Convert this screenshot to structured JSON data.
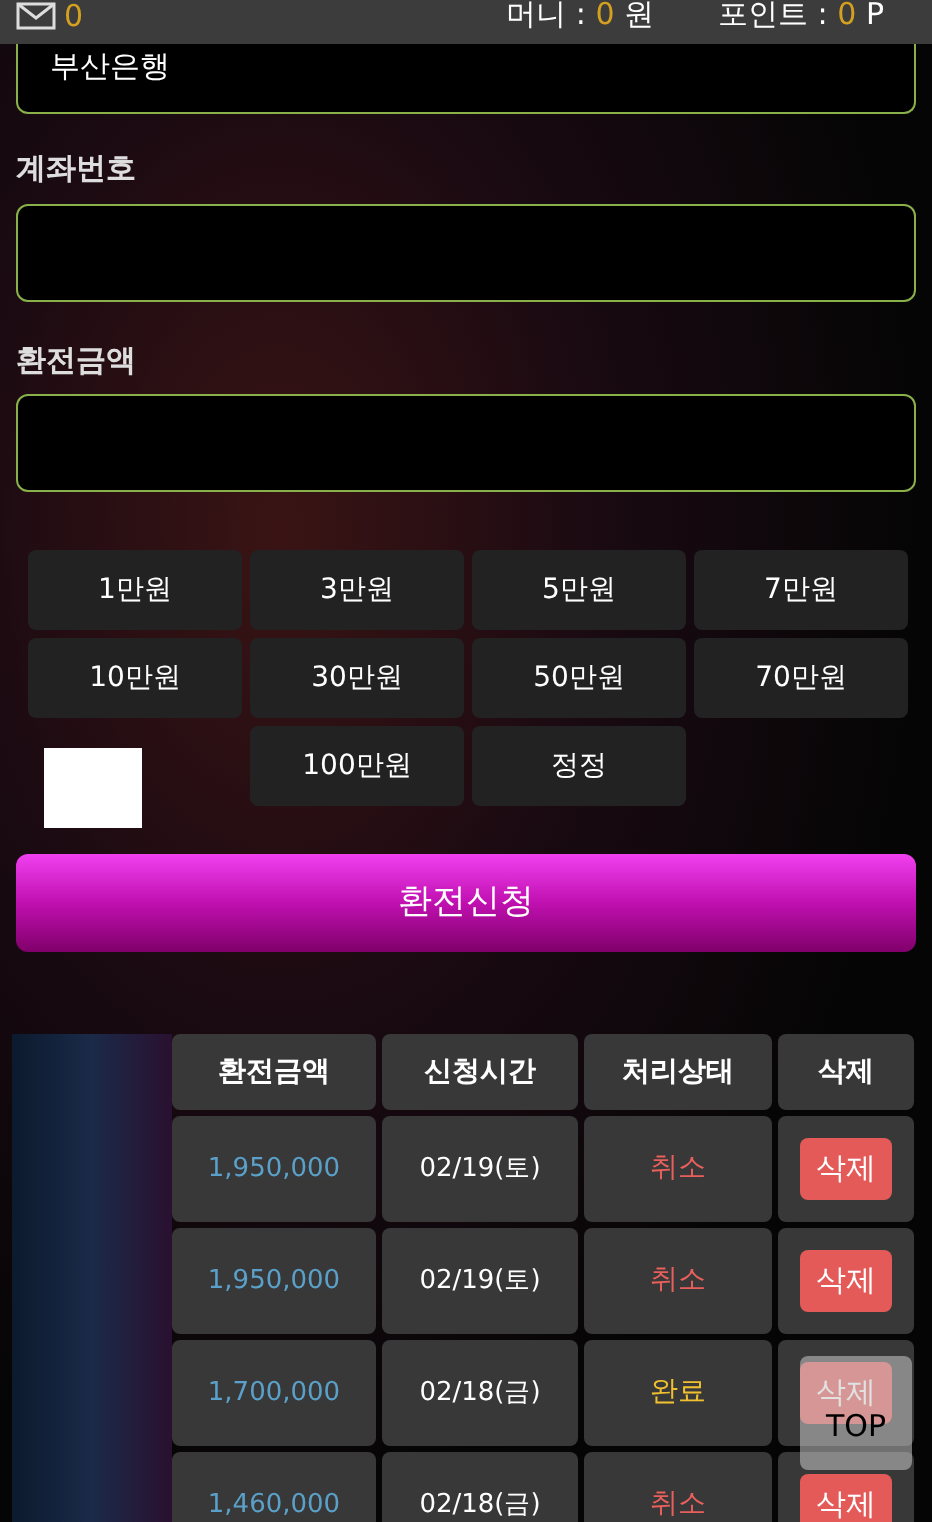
{
  "top_bar": {
    "messages": "0",
    "money_label": "머니 : ",
    "money": "0",
    "money_unit": " 원",
    "points_label": "포인트 : ",
    "points": "0",
    "points_unit": " P"
  },
  "form": {
    "bank": {
      "value": "부산은행"
    },
    "account": {
      "label": "계좌번호"
    },
    "amount": {
      "label": "환전금액"
    }
  },
  "amount_buttons": [
    "1만원",
    "3만원",
    "5만원",
    "7만원",
    "10만원",
    "30만원",
    "50만원",
    "70만원",
    "100만원",
    "정정"
  ],
  "submit": "환전신청",
  "table": {
    "columns": [
      "환전금액",
      "신청시간",
      "처리상태",
      "삭제"
    ],
    "rows": [
      {
        "amount": "1,950,000",
        "time": "02/19(토)",
        "status": {
          "text": "취소",
          "kind": "cancelled"
        },
        "delete": "삭제"
      },
      {
        "amount": "1,950,000",
        "time": "02/19(토)",
        "status": {
          "text": "취소",
          "kind": "cancelled"
        },
        "delete": "삭제"
      },
      {
        "amount": "1,700,000",
        "time": "02/18(금)",
        "status": {
          "text": "완료",
          "kind": "done"
        },
        "delete": "삭제"
      },
      {
        "amount": "1,460,000",
        "time": "02/18(금)",
        "status": {
          "text": "취소",
          "kind": "cancelled"
        },
        "delete": "삭제"
      }
    ]
  },
  "top_button": "TOP"
}
